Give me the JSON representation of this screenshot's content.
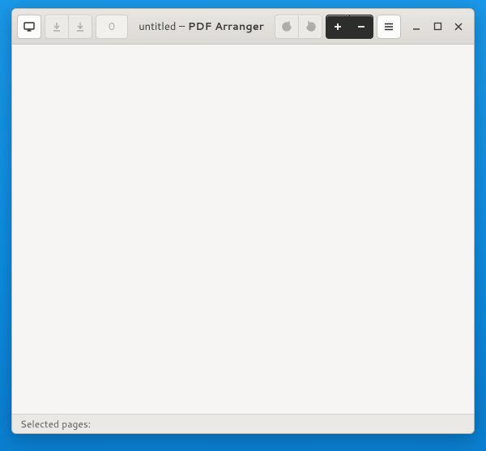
{
  "title_doc": "untitled",
  "title_sep": " – ",
  "title_app": "PDF Arranger",
  "page_number": "0",
  "statusbar_label": "Selected pages:",
  "icons": {
    "open": "open",
    "import": "import",
    "save": "save",
    "rotate_left": "rotate-left",
    "rotate_right": "rotate-right",
    "zoom_in": "zoom-in",
    "zoom_out": "zoom-out",
    "menu": "menu",
    "minimize": "minimize",
    "maximize": "maximize",
    "close": "close"
  }
}
